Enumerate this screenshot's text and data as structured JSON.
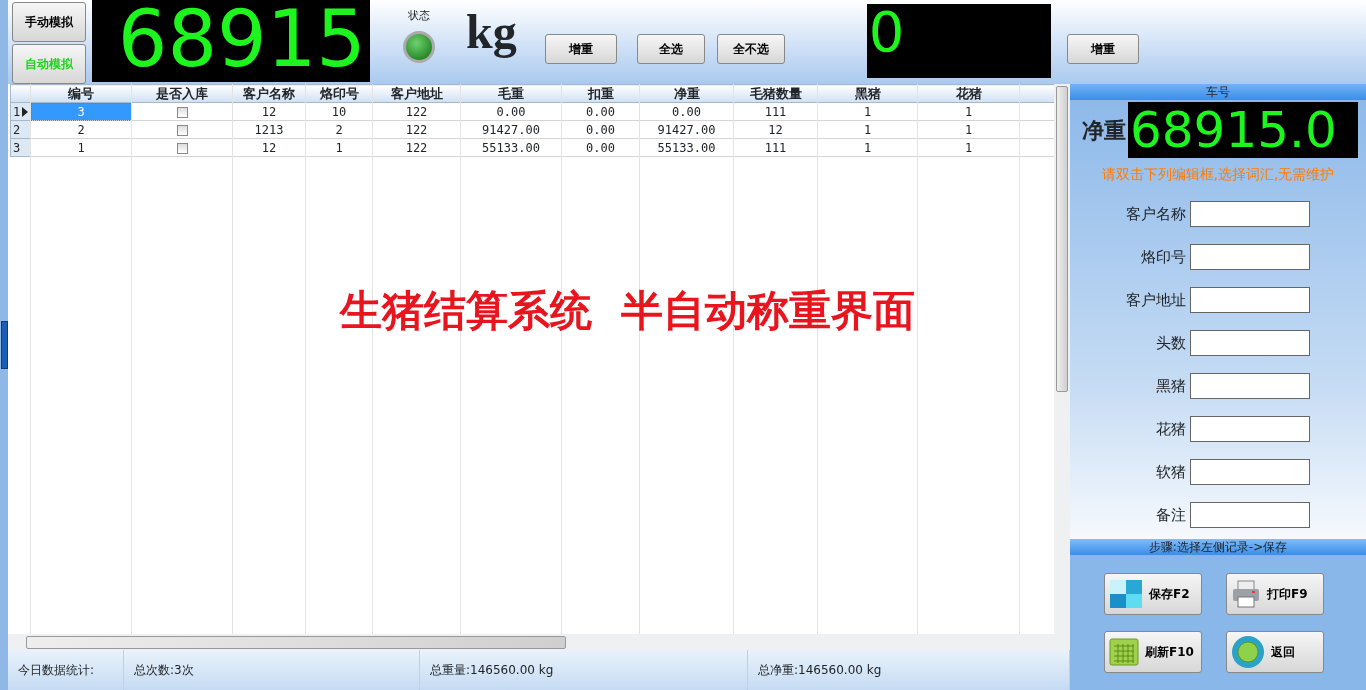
{
  "mode_buttons": [
    {
      "label": "手动模拟",
      "selected": false
    },
    {
      "label": "自动模拟",
      "selected": true
    }
  ],
  "main_display": "68915",
  "status": {
    "label": "状态",
    "on": true
  },
  "unit": "kg",
  "toolbar_buttons": [
    "增重",
    "全选",
    "全不选"
  ],
  "secondary_display": "0",
  "secondary_button": "增重",
  "table": {
    "columns": [
      "编号",
      "是否入库",
      "客户名称",
      "烙印号",
      "客户地址",
      "毛重",
      "扣重",
      "净重",
      "毛猪数量",
      "黑猪",
      "花猪"
    ],
    "rows": [
      {
        "row_header": "1",
        "selected": true,
        "id": "3",
        "stored": false,
        "customer": "12",
        "brand_no": "10",
        "address": "122",
        "gross": "0.00",
        "deduct": "0.00",
        "net": "0.00",
        "hog_count": "111",
        "black": "1",
        "spotted": "1"
      },
      {
        "row_header": "2",
        "selected": false,
        "id": "2",
        "stored": false,
        "customer": "1213",
        "brand_no": "2",
        "address": "122",
        "gross": "91427.00",
        "deduct": "0.00",
        "net": "91427.00",
        "hog_count": "12",
        "black": "1",
        "spotted": "1"
      },
      {
        "row_header": "3",
        "selected": false,
        "id": "1",
        "stored": false,
        "customer": "12",
        "brand_no": "1",
        "address": "122",
        "gross": "55133.00",
        "deduct": "0.00",
        "net": "55133.00",
        "hog_count": "111",
        "black": "1",
        "spotted": "1"
      }
    ]
  },
  "overlay_title": "生猪结算系统  半自动称重界面",
  "status_bar": [
    "今日数据统计:",
    "总次数:3次",
    "总重量:146560.00 kg",
    "总净重:146560.00 kg"
  ],
  "side_panel": {
    "header": "车号",
    "net_label": "净重",
    "net_display": "68915.0",
    "hint": "请双击下列编辑框,选择词汇,无需维护",
    "fields": [
      "客户名称",
      "烙印号",
      "客户地址",
      "头数",
      "黑猪",
      "花猪",
      "软猪",
      "备注"
    ],
    "steps": "步骤:选择左侧记录->保存",
    "buttons": [
      {
        "kind": "save",
        "label": "保存F2"
      },
      {
        "kind": "print",
        "label": "打印F9"
      },
      {
        "kind": "refresh",
        "label": "刷新F10"
      },
      {
        "kind": "back",
        "label": "返回"
      }
    ]
  }
}
